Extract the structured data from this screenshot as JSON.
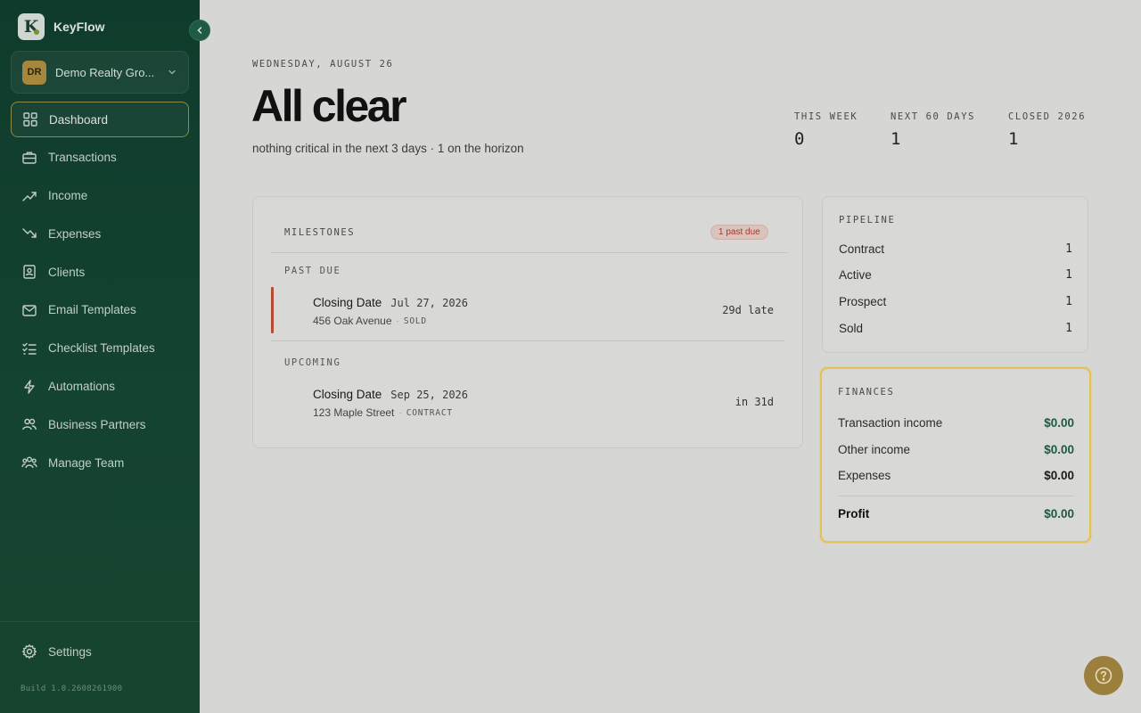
{
  "app": {
    "name": "KeyFlow",
    "logo_letter": "K"
  },
  "org": {
    "initials": "DR",
    "name": "Demo Realty Gro..."
  },
  "nav": [
    {
      "label": "Dashboard",
      "icon": "dashboard-icon",
      "active": true
    },
    {
      "label": "Transactions",
      "icon": "briefcase-icon"
    },
    {
      "label": "Income",
      "icon": "trending-up-icon"
    },
    {
      "label": "Expenses",
      "icon": "trending-down-icon"
    },
    {
      "label": "Clients",
      "icon": "contacts-icon"
    },
    {
      "label": "Email Templates",
      "icon": "mail-icon"
    },
    {
      "label": "Checklist Templates",
      "icon": "checklist-icon"
    },
    {
      "label": "Automations",
      "icon": "bolt-icon"
    },
    {
      "label": "Business Partners",
      "icon": "partners-icon"
    },
    {
      "label": "Manage Team",
      "icon": "team-icon"
    }
  ],
  "settings_label": "Settings",
  "build": "Build 1.0.2608261900",
  "header": {
    "date": "WEDNESDAY, AUGUST 26",
    "title": "All clear",
    "subtitle": "nothing critical in the next 3 days · 1 on the horizon"
  },
  "stats": [
    {
      "label": "THIS WEEK",
      "value": "0"
    },
    {
      "label": "NEXT 60 DAYS",
      "value": "1"
    },
    {
      "label": "CLOSED 2026",
      "value": "1"
    }
  ],
  "milestones": {
    "title": "MILESTONES",
    "badge": "1 past due",
    "past_due_label": "PAST DUE",
    "upcoming_label": "UPCOMING",
    "past_due": {
      "name": "Closing Date",
      "date": "Jul 27, 2026",
      "address": "456 Oak Avenue",
      "status": "SOLD",
      "relative": "29d late"
    },
    "upcoming": {
      "name": "Closing Date",
      "date": "Sep 25, 2026",
      "address": "123 Maple Street",
      "status": "CONTRACT",
      "relative": "in 31d"
    }
  },
  "pipeline": {
    "title": "PIPELINE",
    "rows": [
      {
        "label": "Contract",
        "value": "1"
      },
      {
        "label": "Active",
        "value": "1"
      },
      {
        "label": "Prospect",
        "value": "1"
      },
      {
        "label": "Sold",
        "value": "1"
      }
    ]
  },
  "finances": {
    "title": "FINANCES",
    "transaction_income_label": "Transaction income",
    "transaction_income": "$0.00",
    "other_income_label": "Other income",
    "other_income": "$0.00",
    "expenses_label": "Expenses",
    "expenses": "$0.00",
    "profit_label": "Profit",
    "profit": "$0.00"
  },
  "colors": {
    "sidebar": "#0f3b2c",
    "accent_gold": "#a5873e",
    "money_green": "#1d5a3e",
    "past_due_red": "#b64b33",
    "highlight": "#e6c24e"
  }
}
